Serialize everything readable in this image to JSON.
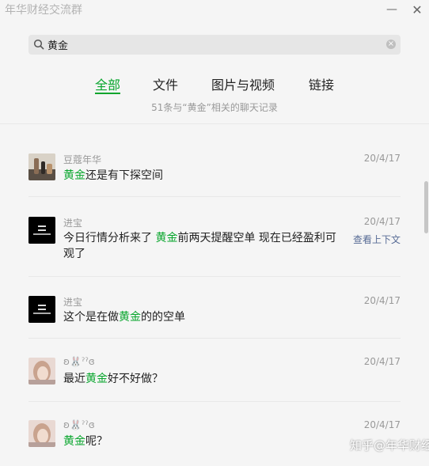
{
  "window": {
    "title": "年华财经交流群"
  },
  "search": {
    "value": "黄金",
    "placeholder": ""
  },
  "tabs": [
    {
      "label": "全部",
      "active": true
    },
    {
      "label": "文件"
    },
    {
      "label": "图片与视频"
    },
    {
      "label": "链接"
    }
  ],
  "summary": "51条与“黄金”相关的聊天记录",
  "results": [
    {
      "sender": "豆蔻年华",
      "date": "20/4/17",
      "parts": [
        "",
        "黄金",
        "还是有下探空间"
      ]
    },
    {
      "sender": "进宝",
      "date": "20/4/17",
      "parts": [
        "今日行情分析来了 ",
        "黄金",
        "前两天提醒空单 现在已经盈利可"
      ],
      "line2": "观了",
      "context_link": "查看上下文"
    },
    {
      "sender": "进宝",
      "date": "20/4/17",
      "parts": [
        "这个是在做",
        "黄金",
        "的的空单"
      ]
    },
    {
      "sender": "ʚ🐰ˀˀɞ",
      "date": "20/4/17",
      "parts": [
        "最近",
        "黄金",
        "好不好做？"
      ]
    },
    {
      "sender": "ʚ🐰ˀˀɞ",
      "date": "20/4/17",
      "parts": [
        "",
        "黄金",
        "呢？"
      ]
    }
  ],
  "watermark": "知乎@年华财经",
  "colors": {
    "highlight": "#07a52c",
    "link": "#576b95",
    "muted": "#999999"
  }
}
